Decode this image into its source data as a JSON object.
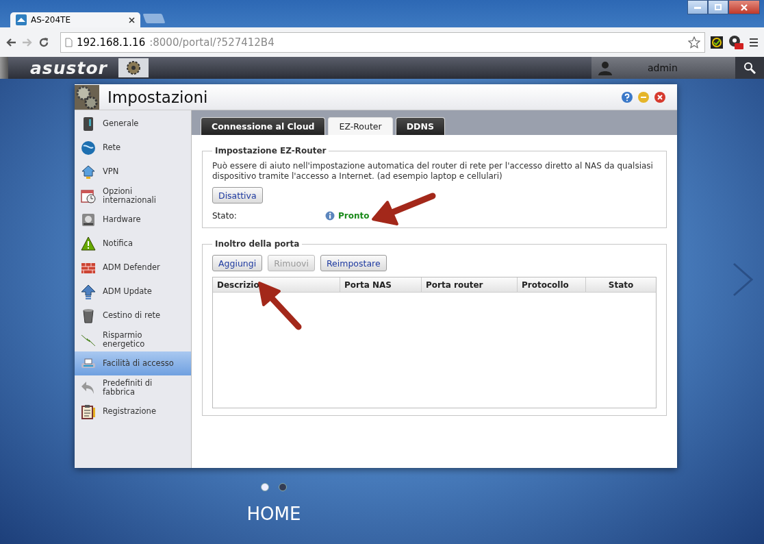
{
  "browser": {
    "tab_title": "AS-204TE",
    "url_host": "192.168.1.16",
    "url_rest": ":8000/portal/?527412B4"
  },
  "app_bar": {
    "logo": "asustor",
    "user": "admin"
  },
  "window": {
    "title": "Impostazioni",
    "sidebar": {
      "items": [
        {
          "label": "Generale",
          "selected": false
        },
        {
          "label": "Rete",
          "selected": false
        },
        {
          "label": "VPN",
          "selected": false
        },
        {
          "label": "Opzioni internazionali",
          "selected": false
        },
        {
          "label": "Hardware",
          "selected": false
        },
        {
          "label": "Notifica",
          "selected": false
        },
        {
          "label": "ADM Defender",
          "selected": false
        },
        {
          "label": "ADM Update",
          "selected": false
        },
        {
          "label": "Cestino di rete",
          "selected": false
        },
        {
          "label": "Risparmio energetico",
          "selected": false
        },
        {
          "label": "Facilità di accesso",
          "selected": true
        },
        {
          "label": "Predefiniti di fabbrica",
          "selected": false
        },
        {
          "label": "Registrazione",
          "selected": false
        }
      ]
    },
    "tabs": [
      {
        "label": "Connessione al Cloud",
        "selected": false
      },
      {
        "label": "EZ-Router",
        "selected": true
      },
      {
        "label": "DDNS",
        "selected": false
      }
    ],
    "ez_router": {
      "legend": "Impostazione EZ-Router",
      "description": "Può essere di aiuto nell'impostazione automatica del router di rete per l'accesso diretto al NAS da qualsiasi dispositivo tramite l'accesso a Internet. (ad esempio laptop e cellulari)",
      "button": "Disattiva",
      "status_label": "Stato:",
      "status_value": "Pronto"
    },
    "port_forwarding": {
      "legend": "Inoltro della porta",
      "buttons": [
        {
          "label": "Aggiungi",
          "disabled": false
        },
        {
          "label": "Rimuovi",
          "disabled": true
        },
        {
          "label": "Reimpostare",
          "disabled": false
        }
      ],
      "table": {
        "columns": [
          "Descrizio",
          "Porta NAS",
          "Porta router",
          "Protocollo",
          "Stato"
        ]
      }
    }
  },
  "pager": {
    "dots": [
      {
        "selected": true
      },
      {
        "selected": false
      }
    ],
    "label": "HOME"
  }
}
